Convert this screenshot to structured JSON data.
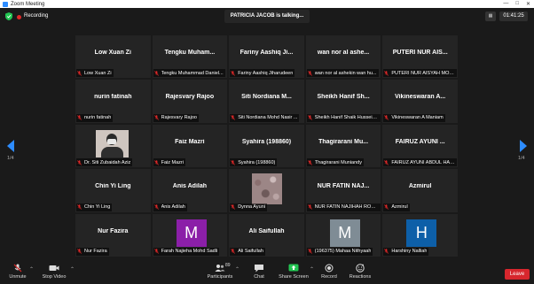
{
  "window": {
    "title": "Zoom Meeting"
  },
  "topbar": {
    "recording_label": "Recording",
    "talking": "PATRICIA JACOB is talking...",
    "timer": "01:41:25"
  },
  "pagination": {
    "left": "1/4",
    "right": "1/4"
  },
  "tiles": [
    {
      "big": "Low Xuan Zi",
      "tag": "Low Xuan Zi",
      "avatar": null
    },
    {
      "big": "Tengku Muham...",
      "tag": "Tengku Muhammad Daniel...",
      "avatar": null
    },
    {
      "big": "Fariny Aashiq Ji...",
      "tag": "Fariny Aashiq Jiharudeen",
      "avatar": null
    },
    {
      "big": "wan nor al ashe...",
      "tag": "wan nor al ashekin wan hu...",
      "avatar": null
    },
    {
      "big": "PUTERI NUR AIS...",
      "tag": "PUTERI NUR AISYAH MOKT...",
      "avatar": null
    },
    {
      "big": "nurin fatinah",
      "tag": "nurin fatinah",
      "avatar": null
    },
    {
      "big": "Rajesvary Rajoo",
      "tag": "Rajesvary Rajoo",
      "avatar": null
    },
    {
      "big": "Siti Nordiana M...",
      "tag": "Siti Nordiana Mohd Nasir ...",
      "avatar": null
    },
    {
      "big": "Sheikh Hanif Sh...",
      "tag": "Sheikh Hanif Shaik Hussein...",
      "avatar": null
    },
    {
      "big": "Vikineswaran A...",
      "tag": "Vikineswaran A Maniam",
      "avatar": null
    },
    {
      "big": "",
      "tag": "Dr. Siti Zubaidah Aziz",
      "avatar": "photo"
    },
    {
      "big": "Faiz Mazri",
      "tag": "Faiz Mazri",
      "avatar": null
    },
    {
      "big": "Syahira (198860)",
      "tag": "Syahira (198860)",
      "avatar": null
    },
    {
      "big": "Thagirarani Mu...",
      "tag": "Thagirarani Muniandy",
      "avatar": null
    },
    {
      "big": "FAIRUZ AYUNI ...",
      "tag": "FAIRUZ AYUNI ABDUL HALIM",
      "avatar": null
    },
    {
      "big": "Chin Yi Ling",
      "tag": "Chin Yi Ling",
      "avatar": null
    },
    {
      "big": "Anis Adilah",
      "tag": "Anis Adilah",
      "avatar": null
    },
    {
      "big": "",
      "tag": "Dynna Ayuni",
      "avatar": "pattern"
    },
    {
      "big": "NUR FATIN NAJ...",
      "tag": "NUR FATIN NAJIHAH ROSL...",
      "avatar": null
    },
    {
      "big": "Azmirul",
      "tag": "Azmirul",
      "avatar": null
    },
    {
      "big": "Nur Fazira",
      "tag": "Nur Fazira",
      "avatar": null
    },
    {
      "big": "",
      "tag": "Farah Najieha Mohd Sadli",
      "avatar": "letter",
      "letter": "M",
      "color": "#8b1fa8"
    },
    {
      "big": "Ali Saifullah",
      "tag": "Ali Saifullah",
      "avatar": null
    },
    {
      "big": "",
      "tag": "(196375) Mahaa Nithyaah",
      "avatar": "letter",
      "letter": "M",
      "color": "#7f8c95"
    },
    {
      "big": "",
      "tag": "Harshiny Nalliah",
      "avatar": "letter",
      "letter": "H",
      "color": "#0d5fa8"
    }
  ],
  "toolbar": {
    "unmute": "Unmute",
    "stop_video": "Stop Video",
    "participants": "Participants",
    "participant_count": "89",
    "chat": "Chat",
    "share_screen": "Share Screen",
    "record": "Record",
    "reactions": "Reactions",
    "leave": "Leave"
  },
  "colors": {
    "accent": "#2d8cff",
    "share_green": "#23c552",
    "leave_red": "#d7262d",
    "muted_red": "#e02828"
  }
}
